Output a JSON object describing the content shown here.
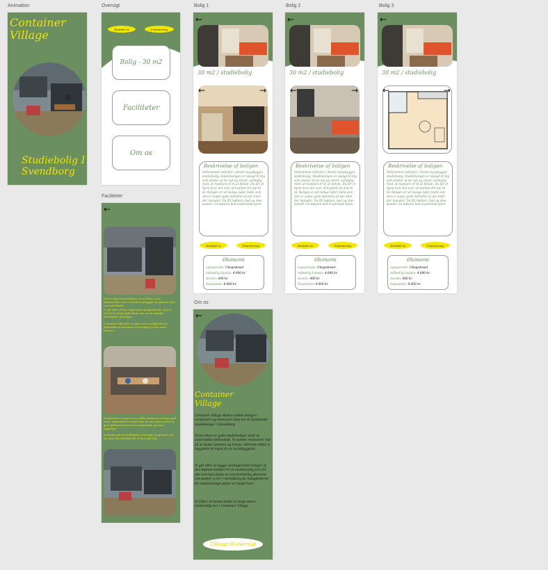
{
  "artboards": {
    "animation": {
      "label": "Animation",
      "title": "Container Village",
      "subtitle": "Studiebolig I Svendborg"
    },
    "oversigt": {
      "label": "Oversigt",
      "pill_left": "Kontakt os",
      "pill_right": "Præmiering",
      "buttons": [
        "Bolig - 30 m2",
        "Faciliteter",
        "Om os"
      ]
    },
    "bolig1": {
      "label": "Bolig 1"
    },
    "bolig2": {
      "label": "Bolig 2"
    },
    "bolig3": {
      "label": "Bolig 3"
    },
    "faciliteter": {
      "label": "Faciliteter",
      "text1": "Det er ingen hemmelighed, at vi elsker vores fællesarealer, hvor vi samles og hygger os sammen med vores faciliteter.",
      "text2": "Vi går efter at lave noget sjovt og spændende, som er med til at skabe fællesskab, som er en naturlig forlængelse af boligen.",
      "text3": "Vi stræber altid efter at gøre vores muligheder for fællesskab så attraktive som muligt for alle vores beboere.",
      "text4": "Værkstedet er noget som vi håber beboerne vil tage godt imod. Værkstedet er stedet hvor du kan være med til at gøre fællesarealerne mere spændende og mere hyggelige.",
      "text5": "Samtidig kan du få tilladelse til at tage ud af huset som kan give dig mulighed for at lave nye ting."
    },
    "omos": {
      "label": "Om os",
      "title": "Container Village",
      "p1": "Container village skaber unikke boliger i containere og renoverer dem om til fantastiske studieboliger i Svendborg.",
      "p2": "Vores fokus er gode studieboliger samt at understøtte fællesskab. Vi samler ressourcer ind på at skabe sammen og trivsel. Allerede inden vi begynder at tegne til en ny bebyggelse.",
      "p3": "Vi går efter at bygge velfungerende boliger af den højeste kvalitet til en studievenlig pris for alle som kan skabe en overkommelig økonomi. Det ønsker vi her i Svendborg da mulighederne for studievenlige priser er meget lave.",
      "p4": "Vi håber at kunne skabe et langt større studiemiljø her i Container Village.",
      "back_button": "Tilbage til oversigt"
    }
  },
  "bolig": {
    "heading": "30 m2 / studiebolig",
    "desc_title": "Beskrivelse af boligen",
    "desc_text": "Velkommen indenfor i denne nyopbygget studiebolig. Studieboligen er oplagt til dig som ønsker at bo nyt og smart, samtidig med, at huslejen er til at betale. Du får et hjem hvor det over af kvalitet fra top til tå. Boligen er så mange lyder mide som den er super godt indrettet så der intet der mangler. Du får køkken, bad og stue samlet i et næsten helt kvadratisk hjem.",
    "pill_left": "Kontakt os",
    "pill_right": "Præmiering",
    "econ_title": "Økonomi",
    "econ": [
      {
        "label": "Lejeperiode:",
        "value": "Ubegrænset"
      },
      {
        "label": "månedlig husleje:",
        "value": "4.000 kr."
      },
      {
        "label": "Aconto:",
        "value": "400 kr."
      },
      {
        "label": "Depositum:",
        "value": "8.000 kr."
      }
    ]
  },
  "colors": {
    "green": "#6b8f5e",
    "yellow": "#f2e400",
    "white": "#ffffff"
  }
}
